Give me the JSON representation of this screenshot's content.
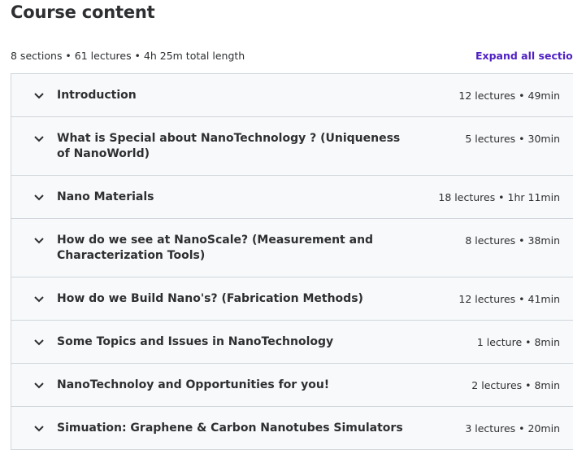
{
  "header": {
    "title": "Course content",
    "summary": "8 sections • 61 lectures • 4h 25m total length",
    "expand_all_label": "Expand all sections"
  },
  "colors": {
    "accent": "#5022c3",
    "row_background": "#f7f9fa",
    "border": "#d1d7dc",
    "text": "#2d2f31"
  },
  "sections": [
    {
      "title": "Introduction",
      "meta": "12 lectures • 49min"
    },
    {
      "title": "What is Special about NanoTechnology ? (Uniqueness of NanoWorld)",
      "meta": "5 lectures • 30min"
    },
    {
      "title": "Nano Materials",
      "meta": "18 lectures • 1hr 11min"
    },
    {
      "title": "How do we see at NanoScale? (Measurement and Characterization Tools)",
      "meta": "8 lectures • 38min"
    },
    {
      "title": "How do we Build Nano's? (Fabrication Methods)",
      "meta": "12 lectures • 41min"
    },
    {
      "title": "Some Topics and Issues in NanoTechnology",
      "meta": "1 lecture • 8min"
    },
    {
      "title": "NanoTechnoloy and Opportunities for you!",
      "meta": "2 lectures • 8min"
    },
    {
      "title": "Simuation: Graphene & Carbon Nanotubes Simulators",
      "meta": "3 lectures • 20min"
    }
  ],
  "icons": {
    "section_toggle": "chevron-down-icon"
  }
}
